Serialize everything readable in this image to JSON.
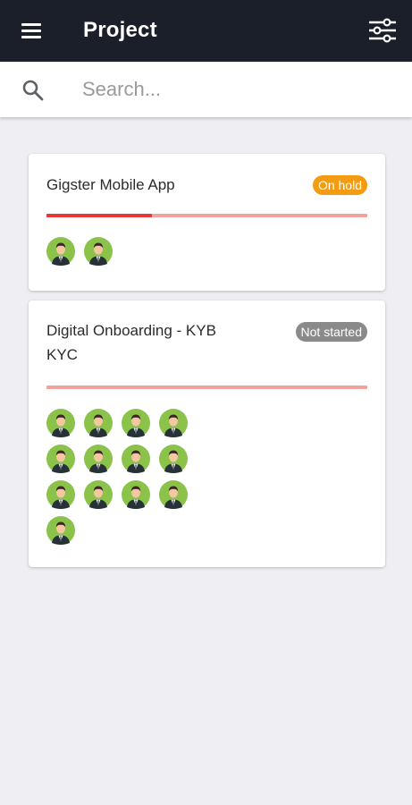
{
  "app_bar": {
    "title": "Project",
    "menu_icon": "menu-icon",
    "filter_icon": "filter-sliders-icon",
    "background": "#1b1f2a"
  },
  "search": {
    "placeholder": "Search...",
    "value": "",
    "icon": "search-icon"
  },
  "projects": [
    {
      "title": "Gigster Mobile App",
      "status": "On hold",
      "status_color": "#f39c12",
      "progress": 0.33,
      "progress_color": "#e53935",
      "progress_track_color": "#f2a3a0",
      "member_count": 2
    },
    {
      "title": "Digital Onboarding - KYB KYC",
      "status": "Not started",
      "status_color": "#8a8a8a",
      "progress": 0,
      "progress_color": "#e53935",
      "progress_track_color": "#f2a3a0",
      "member_count": 13
    }
  ]
}
